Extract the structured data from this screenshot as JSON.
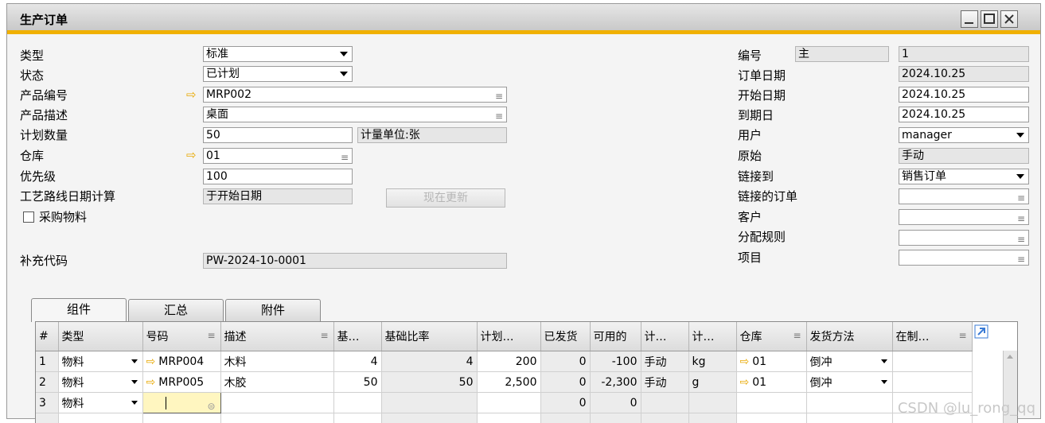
{
  "window": {
    "title": "生产订单"
  },
  "left": {
    "type": {
      "label": "类型",
      "value": "标准"
    },
    "status": {
      "label": "状态",
      "value": "已计划"
    },
    "product_no": {
      "label": "产品编号",
      "value": "MRP002"
    },
    "product_desc": {
      "label": "产品描述",
      "value": "桌面"
    },
    "planned_qty": {
      "label": "计划数量",
      "value": "50"
    },
    "uom": {
      "value": "计量单位:张"
    },
    "warehouse": {
      "label": "仓库",
      "value": "01"
    },
    "priority": {
      "label": "优先级",
      "value": "100"
    },
    "routing_date": {
      "label": "工艺路线日期计算",
      "value": "于开始日期"
    },
    "update_button": "现在更新",
    "purchase_material": {
      "label": "采购物料",
      "checked": false
    },
    "supplement_code": {
      "label": "补充代码",
      "value": "PW-2024-10-0001"
    }
  },
  "right": {
    "number": {
      "label": "编号",
      "series": "主",
      "value": "1"
    },
    "order_date": {
      "label": "订单日期",
      "value": "2024.10.25"
    },
    "start_date": {
      "label": "开始日期",
      "value": "2024.10.25"
    },
    "due_date": {
      "label": "到期日",
      "value": "2024.10.25"
    },
    "user": {
      "label": "用户",
      "value": "manager"
    },
    "origin": {
      "label": "原始",
      "value": "手动"
    },
    "linked_to": {
      "label": "链接到",
      "value": "销售订单"
    },
    "linked_order": {
      "label": "链接的订单",
      "value": ""
    },
    "customer": {
      "label": "客户",
      "value": ""
    },
    "distribution_rule": {
      "label": "分配规则",
      "value": ""
    },
    "project": {
      "label": "项目",
      "value": ""
    }
  },
  "tabs": [
    "组件",
    "汇总",
    "附件"
  ],
  "grid": {
    "headers": [
      "#",
      "类型",
      "号码",
      "描述",
      "基…",
      "基础比率",
      "计划…",
      "已发货",
      "可用的",
      "计…",
      "计…",
      "仓库",
      "发货方法",
      "在制…"
    ],
    "rows": [
      {
        "no": "1",
        "type": "物料",
        "item": "MRP004",
        "desc": "木料",
        "base": "4",
        "ratio": "4",
        "planned": "200",
        "issued": "0",
        "available": "-100",
        "method": "手动",
        "uom": "kg",
        "wh": "01",
        "issue": "倒冲",
        "wip": ""
      },
      {
        "no": "2",
        "type": "物料",
        "item": "MRP005",
        "desc": "木胶",
        "base": "50",
        "ratio": "50",
        "planned": "2,500",
        "issued": "0",
        "available": "-2,300",
        "method": "手动",
        "uom": "g",
        "wh": "01",
        "issue": "倒冲",
        "wip": ""
      },
      {
        "no": "3",
        "type": "物料",
        "item": "",
        "desc": "",
        "base": "",
        "ratio": "",
        "planned": "",
        "issued": "0",
        "available": "0",
        "method": "",
        "uom": "",
        "wh": "",
        "issue": "",
        "wip": ""
      }
    ]
  },
  "watermark": "CSDN @lu_rong_qq",
  "colors": {
    "accent": "#f0b000",
    "arrow": "#e8a800"
  }
}
